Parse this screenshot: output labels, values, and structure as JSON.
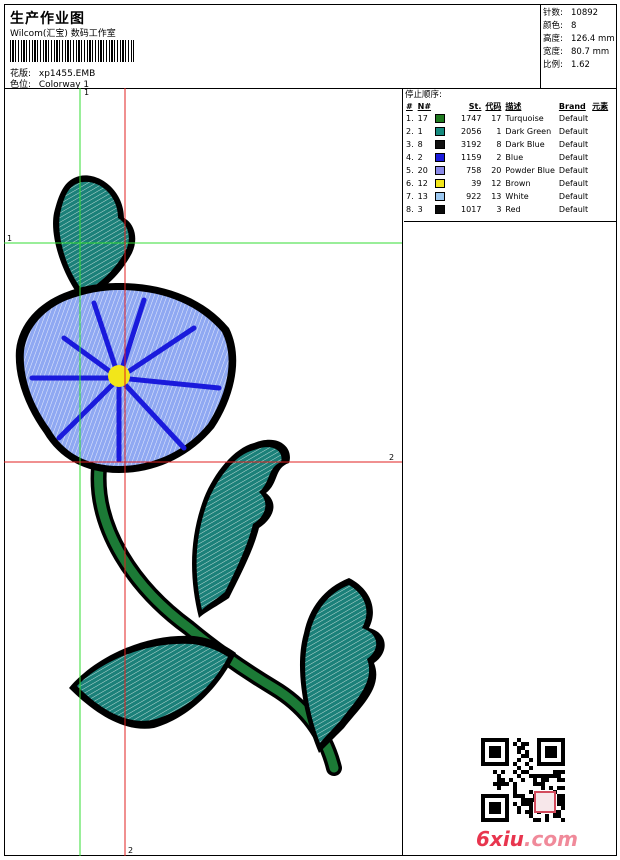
{
  "header": {
    "title": "生产作业图",
    "subtitle": "Wilcom(汇宝) 数码工作室",
    "design_label": "花版:",
    "design_value": "xp1455.EMB",
    "colorway_label": "色位:",
    "colorway_value": "Colorway 1"
  },
  "stats": [
    {
      "label": "针数:",
      "value": "10892"
    },
    {
      "label": "颜色:",
      "value": "8"
    },
    {
      "label": "高度:",
      "value": "126.4 mm"
    },
    {
      "label": "宽度:",
      "value": "80.7 mm"
    },
    {
      "label": "比例:",
      "value": "1.62"
    }
  ],
  "guides": {
    "v1_label": "1",
    "h1_label": "1",
    "h2_label": "2",
    "v2_label": "2"
  },
  "stop_sequence": {
    "title": "停止顺序:",
    "columns": [
      "#",
      "N#",
      "St.",
      "代码",
      "描述",
      "Brand",
      "元素"
    ],
    "rows": [
      {
        "idx": "1.",
        "n": "17",
        "color": "#1f7a1f",
        "st": "1747",
        "code": "17",
        "desc": "Turquoise",
        "brand": "Default"
      },
      {
        "idx": "2.",
        "n": "1",
        "color": "#168a7e",
        "st": "2056",
        "code": "1",
        "desc": "Dark Green",
        "brand": "Default"
      },
      {
        "idx": "3.",
        "n": "8",
        "color": "#111111",
        "st": "3192",
        "code": "8",
        "desc": "Dark Blue",
        "brand": "Default"
      },
      {
        "idx": "4.",
        "n": "2",
        "color": "#1a1adc",
        "st": "1159",
        "code": "2",
        "desc": "Blue",
        "brand": "Default"
      },
      {
        "idx": "5.",
        "n": "20",
        "color": "#8a8ae8",
        "st": "758",
        "code": "20",
        "desc": "Powder Blue",
        "brand": "Default"
      },
      {
        "idx": "6.",
        "n": "12",
        "color": "#f2e61a",
        "st": "39",
        "code": "12",
        "desc": "Brown",
        "brand": "Default"
      },
      {
        "idx": "7.",
        "n": "13",
        "color": "#9cc8f0",
        "st": "922",
        "code": "13",
        "desc": "White",
        "brand": "Default"
      },
      {
        "idx": "8.",
        "n": "3",
        "color": "#0a0a0a",
        "st": "1017",
        "code": "3",
        "desc": "Red",
        "brand": "Default"
      }
    ]
  },
  "watermark": {
    "text_a": "6xiu",
    "text_b": ".com"
  }
}
